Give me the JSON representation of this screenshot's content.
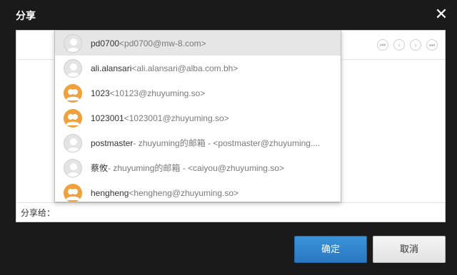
{
  "dialog": {
    "title": "分享",
    "close_icon": "close-icon",
    "pager_icons": [
      "first-page-icon",
      "prev-page-icon",
      "next-page-icon",
      "last-page-icon"
    ],
    "share_to_label": "分享给：",
    "ok_label": "确定",
    "cancel_label": "取消",
    "colors": {
      "accent": "#2a78c2",
      "avatar_orange": "#f0a13b"
    }
  },
  "suggestions": [
    {
      "name": "pd0700",
      "detail": "<pd0700@mw-8.com>",
      "avatar": "gray"
    },
    {
      "name": "ali.alansari",
      "detail": "<ali.alansari@alba.com.bh>",
      "avatar": "gray"
    },
    {
      "name": "1023",
      "detail": "<10123@zhuyuming.so>",
      "avatar": "orange"
    },
    {
      "name": "1023001",
      "detail": "<1023001@zhuyuming.so>",
      "avatar": "orange"
    },
    {
      "name": "postmaster",
      "detail": " - zhuyuming的邮箱 - <postmaster@zhuyuming....",
      "avatar": "gray"
    },
    {
      "name": "蔡攸",
      "detail": " - zhuyuming的邮箱 - <caiyou@zhuyuming.so>",
      "avatar": "gray"
    },
    {
      "name": "hengheng",
      "detail": "<hengheng@zhuyuming.so>",
      "avatar": "orange"
    }
  ]
}
